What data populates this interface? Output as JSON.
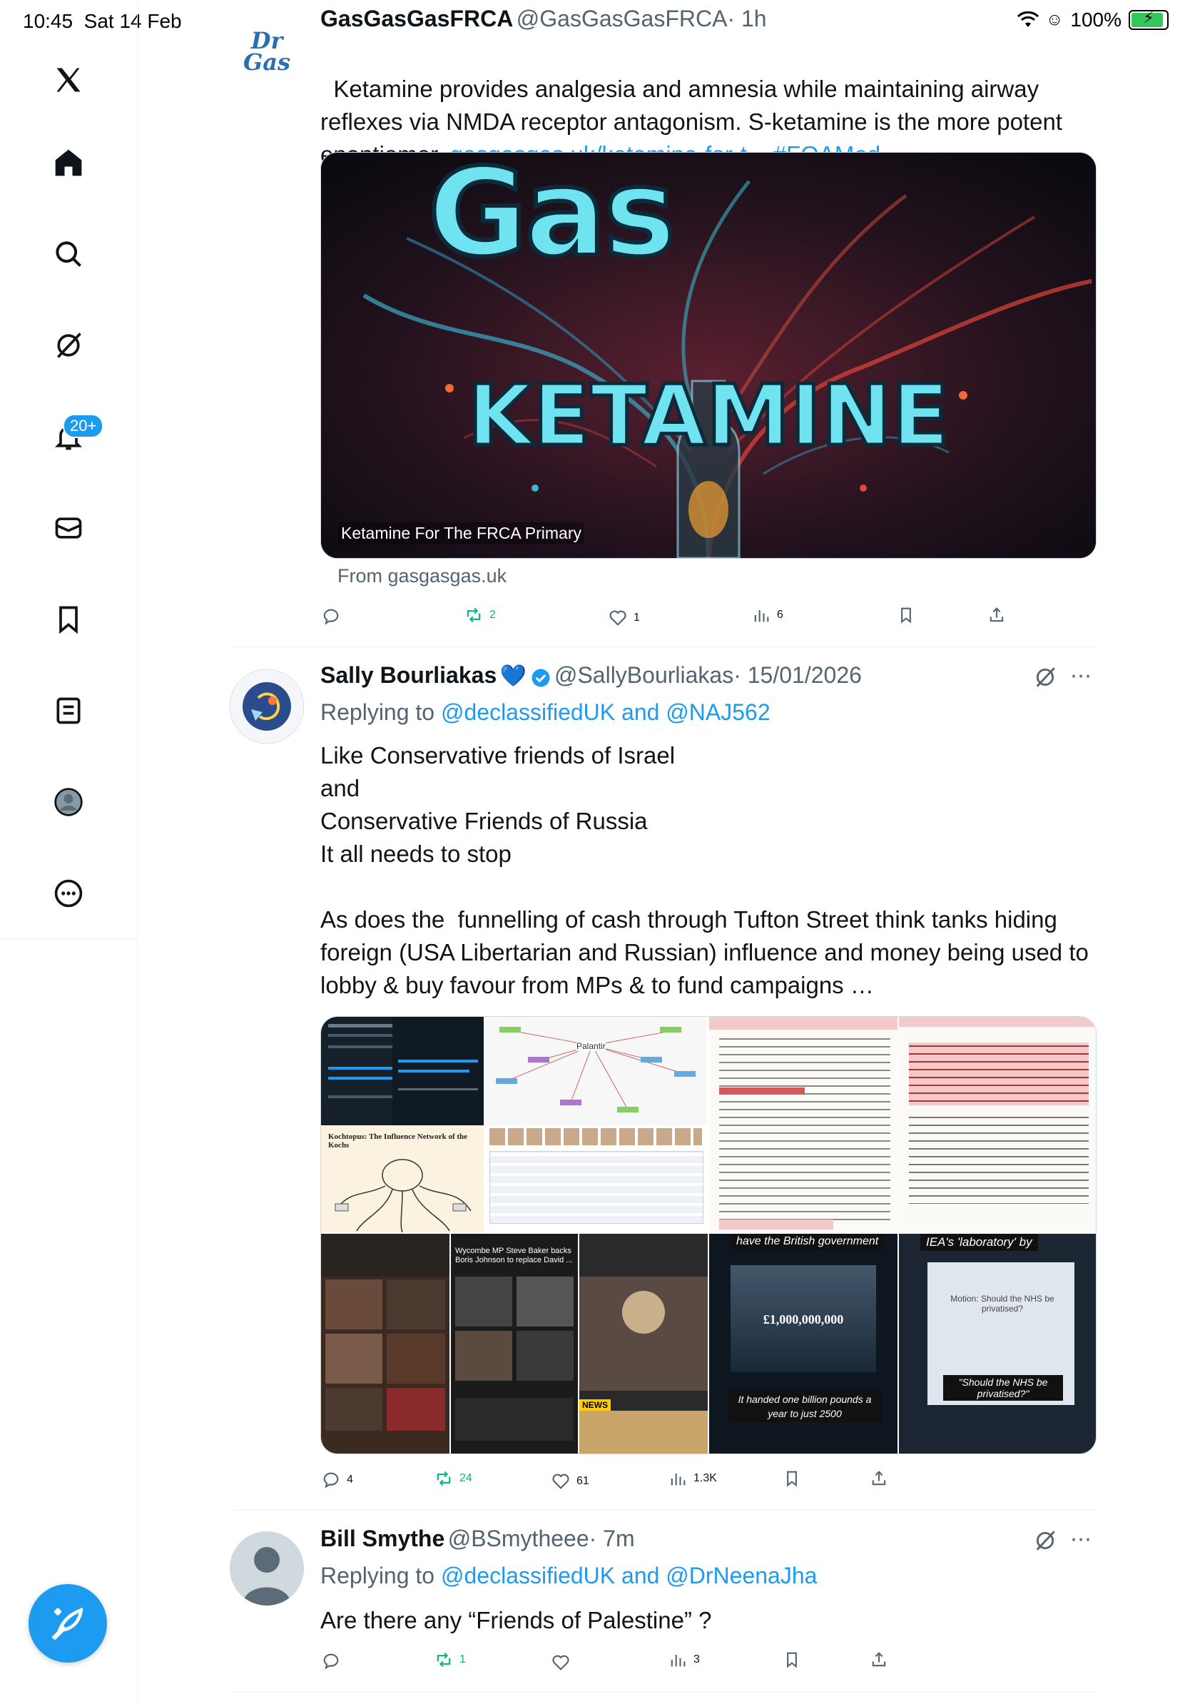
{
  "status_bar": {
    "time": "10:45",
    "date": "Sat 14 Feb",
    "battery": "100%"
  },
  "sidebar": {
    "items": [
      {
        "icon": "x-logo-icon"
      },
      {
        "icon": "home-icon"
      },
      {
        "icon": "search-icon"
      },
      {
        "icon": "grok-icon"
      },
      {
        "icon": "bell-icon"
      },
      {
        "icon": "mail-icon"
      },
      {
        "icon": "bookmark-icon"
      },
      {
        "icon": "list-icon"
      },
      {
        "icon": "profile-icon"
      },
      {
        "icon": "more-icon"
      }
    ],
    "notifications_badge": "20+"
  },
  "tweets": [
    {
      "name": "GasGasGasFRCA",
      "handle": "@GasGasGasFRCA",
      "time": "· 1h",
      "avatar_text": "Dr Gas",
      "text": "Ketamine provides analgesia and amnesia while maintaining airway reflexes via NMDA receptor antagonism. S-ketamine is the more potent enantiomer. ",
      "link": "gasgasgas.uk/ketamine-for-t...",
      "hashtag": "#FOAMed",
      "card": {
        "image_title_top": "Gas",
        "image_title_main": "KETAMINE",
        "caption": "Ketamine For The FRCA Primary",
        "source": "From gasgasgas.uk"
      },
      "stats": {
        "replies": "",
        "reposts": "2",
        "likes": "1",
        "views": "6"
      }
    },
    {
      "name": "Sally Bourliakas",
      "emoji": "💙",
      "handle": "@SallyBourliakas",
      "time": "· 15/01/2026",
      "replying_prefix": "Replying to ",
      "replying_to": "@declassifiedUK and @NAJ562",
      "text": "Like Conservative friends of Israel\nand\nConservative Friends of Russia\nIt all needs to stop\n\nAs does the  funnelling of cash through Tufton Street think tanks hiding foreign (USA Libertarian and Russian) influence and money being used to lobby & buy favour from MPs & to fund campaigns …",
      "media": {
        "tile_palantir": "Palantir",
        "tile_kochtopus": "Kochtopus: The Influence Network of the Kochs",
        "tile_british": "have the British government",
        "tile_billion": "£1,000,000,000",
        "tile_billion_caption": "It handed one billion pounds a year to just 2500",
        "tile_iea": "IEA's 'laboratory' by",
        "tile_nhs_top": "Motion: Should the NHS be privatised?",
        "tile_nhs_caption": "\"Should the NHS be privatised?\"",
        "tile_baker": "Wycombe MP Steve Baker backs Boris Johnson to replace David ...",
        "tile_news": "NEWS"
      },
      "stats": {
        "replies": "4",
        "reposts": "24",
        "likes": "61",
        "views": "1.3K"
      }
    },
    {
      "name": "Bill Smythe",
      "handle": "@BSmytheee",
      "time": "· 7m",
      "replying_prefix": "Replying to ",
      "replying_to": "@declassifiedUK and @DrNeenaJha",
      "text": "Are there any “Friends of Palestine” ?",
      "stats": {
        "replies": "",
        "reposts": "1",
        "likes": "",
        "views": "3"
      }
    }
  ],
  "colors": {
    "accent": "#1d9bf0",
    "repost": "#00ba7c",
    "muted": "#536471",
    "text": "#0f1419"
  }
}
